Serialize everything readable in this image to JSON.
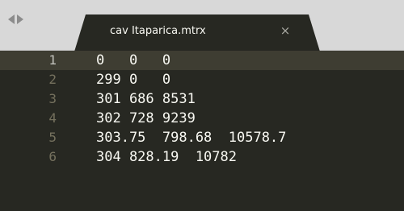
{
  "tab": {
    "title": "cav Itaparica.mtrx",
    "close_glyph": "×"
  },
  "icons": {
    "nav_back": "left-triangle",
    "nav_forward": "right-triangle"
  },
  "colors": {
    "editor_bg": "#272822",
    "active_line_bg": "#3e3d32",
    "text": "#f8f8f2",
    "line_number": "#75715e",
    "tabbar_bg": "#d8d8d8"
  },
  "editor": {
    "active_line": 1,
    "lines": [
      {
        "number": "1",
        "text": "0   0   0"
      },
      {
        "number": "2",
        "text": "299 0   0"
      },
      {
        "number": "3",
        "text": "301 686 8531"
      },
      {
        "number": "4",
        "text": "302 728 9239"
      },
      {
        "number": "5",
        "text": "303.75  798.68  10578.7"
      },
      {
        "number": "6",
        "text": "304 828.19  10782"
      }
    ]
  }
}
